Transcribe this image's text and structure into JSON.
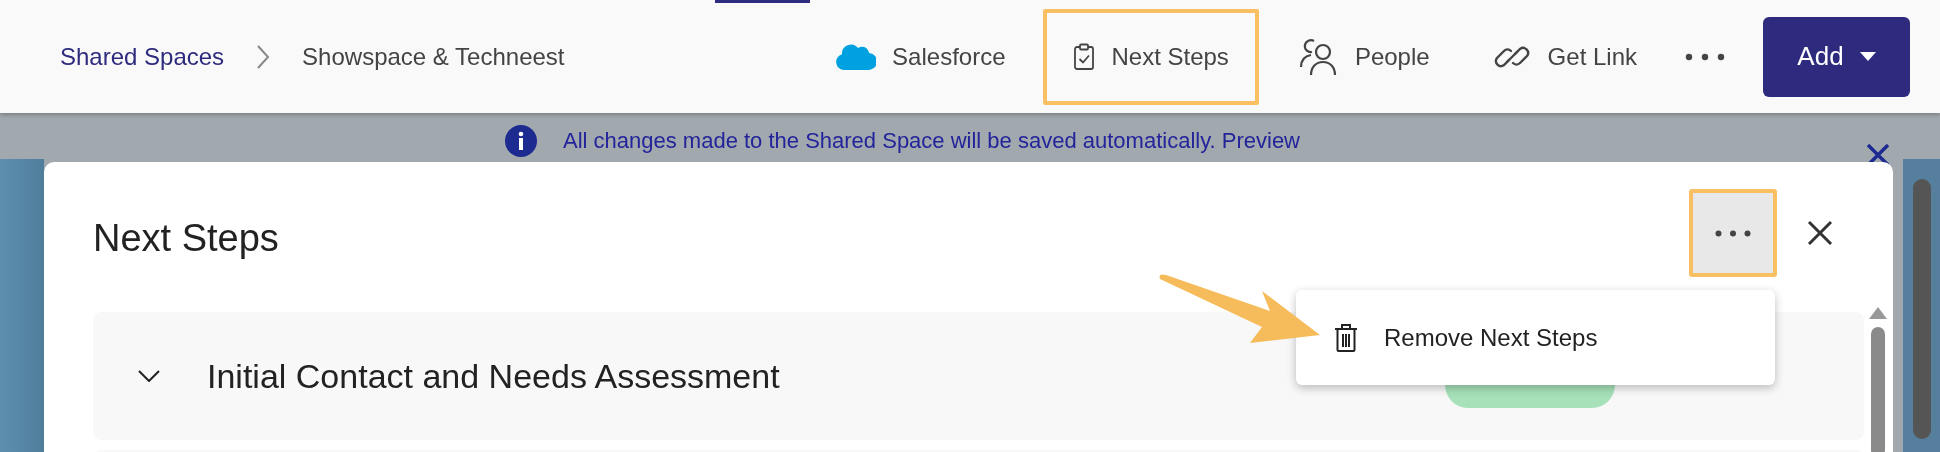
{
  "top_bar": {
    "breadcrumb": [
      {
        "label": "Shared Spaces",
        "kind": "link"
      },
      {
        "label": "Showspace & Techneest",
        "kind": "current"
      }
    ],
    "actions": [
      {
        "label": "Salesforce",
        "highlighted": false
      },
      {
        "label": "Next Steps",
        "highlighted": true
      },
      {
        "label": "People",
        "highlighted": false
      },
      {
        "label": "Get Link",
        "highlighted": false
      }
    ],
    "add_button": {
      "label": "Add"
    }
  },
  "banner": {
    "message": "All changes made to the Shared Space will be saved automatically.",
    "link": "Preview"
  },
  "dialog": {
    "title": "Next Steps",
    "more_highlighted": true,
    "sections": [
      {
        "title": "Initial Contact and Needs Assessment"
      }
    ]
  },
  "menu": {
    "items": [
      {
        "label": "Remove Next Steps"
      }
    ]
  }
}
